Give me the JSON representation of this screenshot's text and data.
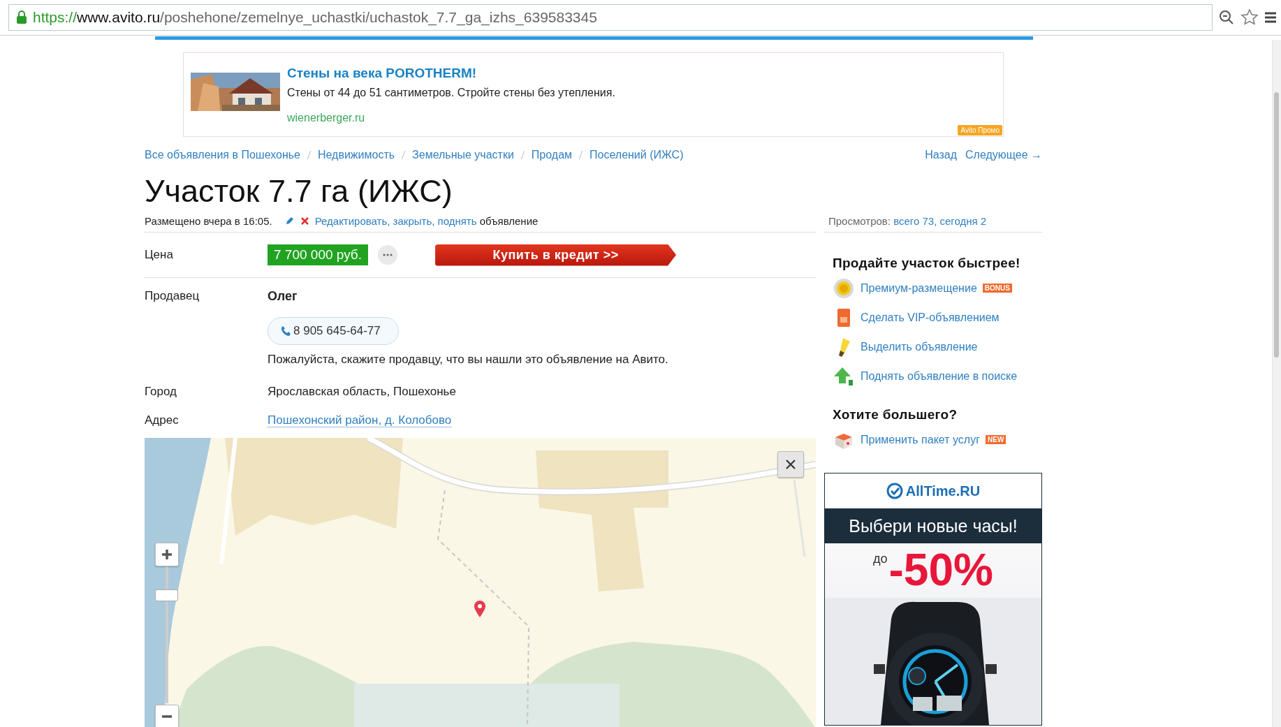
{
  "browser": {
    "url_scheme": "https://",
    "url_host": "www.avito.ru",
    "url_path": "/poshehone/zemelnye_uchastki/uchastok_7.7_ga_izhs_639583345"
  },
  "promo": {
    "title": "Стены на века POROTHERM!",
    "text": "Стены от 44 до 51 сантиметров. Стройте стены без утепления.",
    "domain": "wienerberger.ru",
    "badge": "Avito Промо"
  },
  "breadcrumbs": [
    "Все объявления в Пошехонье",
    "Недвижимость",
    "Земельные участки",
    "Продам",
    "Поселений (ИЖС)"
  ],
  "nav": [
    "Назад",
    "Следующее →"
  ],
  "title": "Участок 7.7 га (ИЖС)",
  "posted": "Размещено вчера в 16:05.",
  "edit": {
    "link": "Редактировать, закрыть, поднять",
    "suffix": "объявление"
  },
  "views": {
    "label": "Просмотров:",
    "value": "всего 73, сегодня 2"
  },
  "price": {
    "label": "Цена",
    "value": "7 700 000 руб.",
    "credit_button": "Купить в кредит >>"
  },
  "seller": {
    "label": "Продавец",
    "name": "Олег",
    "phone": "8 905 645-64-77",
    "note": "Пожалуйста, скажите продавцу, что вы нашли это объявление на Авито."
  },
  "city": {
    "label": "Город",
    "value": "Ярославская область, Пошехонье"
  },
  "address": {
    "label": "Адрес",
    "value": "Пошехонский район, д. Колобово"
  },
  "map": {
    "kind": "picture",
    "zoom": {
      "level": 0.82
    }
  },
  "promote": {
    "title": "Продайте участок быстрее!",
    "items": [
      {
        "kind": "premium",
        "label": "Премиум-размещение",
        "badge": "BONUS"
      },
      {
        "kind": "vip",
        "label": "Сделать VIP-объявлением"
      },
      {
        "kind": "highlight",
        "label": "Выделить объявление"
      },
      {
        "kind": "raise",
        "label": "Поднять объявление в поиске"
      }
    ]
  },
  "more": {
    "title": "Хотите большего?",
    "items": [
      {
        "kind": "package",
        "label": "Применить пакет услуг",
        "badge": "NEW"
      }
    ]
  },
  "banner": {
    "brand": "AllTime.RU",
    "headline": "Выбери новые часы!",
    "prefix": "до",
    "discount": "-50%"
  }
}
